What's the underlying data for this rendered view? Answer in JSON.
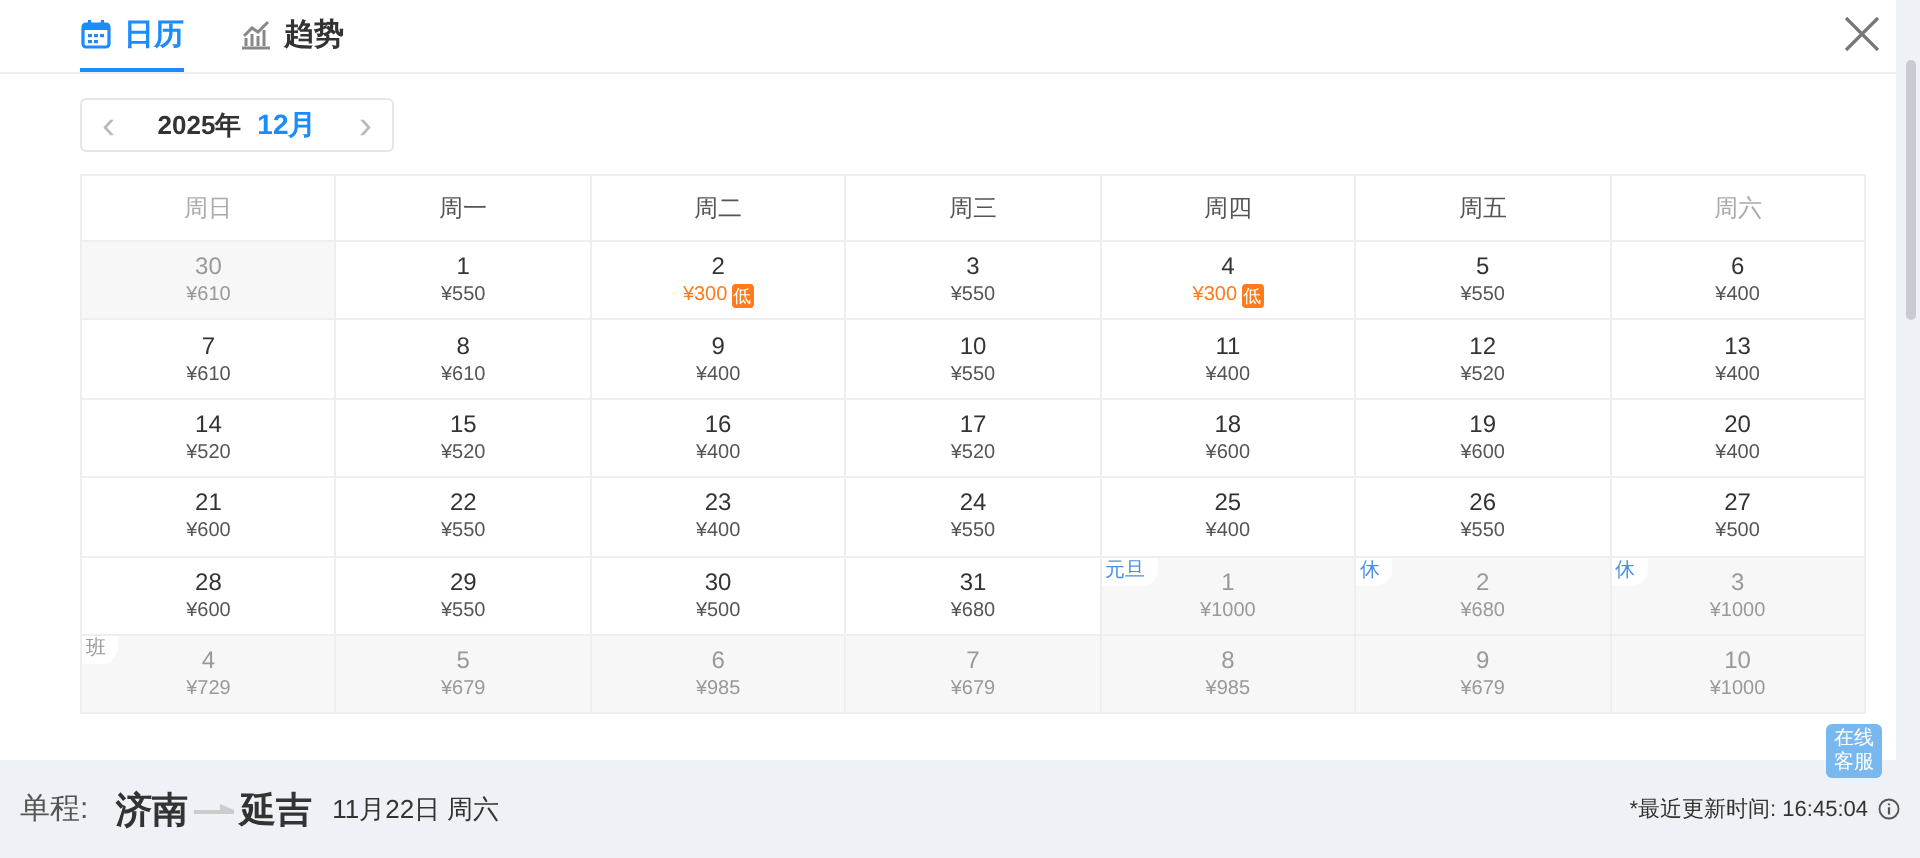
{
  "tabs": [
    {
      "label": "日历",
      "selected": true
    },
    {
      "label": "趋势",
      "selected": false
    }
  ],
  "month_picker": {
    "year": "2025年",
    "month": "12月",
    "prev": "‹",
    "next": "›"
  },
  "weekdays": [
    {
      "label": "周日",
      "weekend": true
    },
    {
      "label": "周一",
      "weekend": false
    },
    {
      "label": "周二",
      "weekend": false
    },
    {
      "label": "周三",
      "weekend": false
    },
    {
      "label": "周四",
      "weekend": false
    },
    {
      "label": "周五",
      "weekend": false
    },
    {
      "label": "周六",
      "weekend": true
    }
  ],
  "weeks": [
    [
      {
        "day": "30",
        "price": "¥610",
        "other_month": true,
        "low": false
      },
      {
        "day": "1",
        "price": "¥550",
        "other_month": false,
        "low": false
      },
      {
        "day": "2",
        "price": "¥300",
        "other_month": false,
        "low": true,
        "badge": "低"
      },
      {
        "day": "3",
        "price": "¥550",
        "other_month": false,
        "low": false
      },
      {
        "day": "4",
        "price": "¥300",
        "other_month": false,
        "low": true,
        "badge": "低"
      },
      {
        "day": "5",
        "price": "¥550",
        "other_month": false,
        "low": false
      },
      {
        "day": "6",
        "price": "¥400",
        "other_month": false,
        "low": false
      }
    ],
    [
      {
        "day": "7",
        "price": "¥610",
        "other_month": false,
        "low": false
      },
      {
        "day": "8",
        "price": "¥610",
        "other_month": false,
        "low": false
      },
      {
        "day": "9",
        "price": "¥400",
        "other_month": false,
        "low": false
      },
      {
        "day": "10",
        "price": "¥550",
        "other_month": false,
        "low": false
      },
      {
        "day": "11",
        "price": "¥400",
        "other_month": false,
        "low": false
      },
      {
        "day": "12",
        "price": "¥520",
        "other_month": false,
        "low": false
      },
      {
        "day": "13",
        "price": "¥400",
        "other_month": false,
        "low": false
      }
    ],
    [
      {
        "day": "14",
        "price": "¥520",
        "other_month": false,
        "low": false
      },
      {
        "day": "15",
        "price": "¥520",
        "other_month": false,
        "low": false
      },
      {
        "day": "16",
        "price": "¥400",
        "other_month": false,
        "low": false
      },
      {
        "day": "17",
        "price": "¥520",
        "other_month": false,
        "low": false
      },
      {
        "day": "18",
        "price": "¥600",
        "other_month": false,
        "low": false
      },
      {
        "day": "19",
        "price": "¥600",
        "other_month": false,
        "low": false
      },
      {
        "day": "20",
        "price": "¥400",
        "other_month": false,
        "low": false
      }
    ],
    [
      {
        "day": "21",
        "price": "¥600",
        "other_month": false,
        "low": false
      },
      {
        "day": "22",
        "price": "¥550",
        "other_month": false,
        "low": false
      },
      {
        "day": "23",
        "price": "¥400",
        "other_month": false,
        "low": false
      },
      {
        "day": "24",
        "price": "¥550",
        "other_month": false,
        "low": false
      },
      {
        "day": "25",
        "price": "¥400",
        "other_month": false,
        "low": false
      },
      {
        "day": "26",
        "price": "¥550",
        "other_month": false,
        "low": false
      },
      {
        "day": "27",
        "price": "¥500",
        "other_month": false,
        "low": false
      }
    ],
    [
      {
        "day": "28",
        "price": "¥600",
        "other_month": false,
        "low": false
      },
      {
        "day": "29",
        "price": "¥550",
        "other_month": false,
        "low": false
      },
      {
        "day": "30",
        "price": "¥500",
        "other_month": false,
        "low": false
      },
      {
        "day": "31",
        "price": "¥680",
        "other_month": false,
        "low": false
      },
      {
        "day": "1",
        "price": "¥1000",
        "other_month": true,
        "low": false,
        "tag": {
          "text": "元旦",
          "kind": "holiday"
        }
      },
      {
        "day": "2",
        "price": "¥680",
        "other_month": true,
        "low": false,
        "tag": {
          "text": "休",
          "kind": "holiday"
        }
      },
      {
        "day": "3",
        "price": "¥1000",
        "other_month": true,
        "low": false,
        "tag": {
          "text": "休",
          "kind": "holiday"
        }
      }
    ],
    [
      {
        "day": "4",
        "price": "¥729",
        "other_month": true,
        "low": false,
        "tag": {
          "text": "班",
          "kind": "workday"
        }
      },
      {
        "day": "5",
        "price": "¥679",
        "other_month": true,
        "low": false
      },
      {
        "day": "6",
        "price": "¥985",
        "other_month": true,
        "low": false
      },
      {
        "day": "7",
        "price": "¥679",
        "other_month": true,
        "low": false
      },
      {
        "day": "8",
        "price": "¥985",
        "other_month": true,
        "low": false
      },
      {
        "day": "9",
        "price": "¥679",
        "other_month": true,
        "low": false
      },
      {
        "day": "10",
        "price": "¥1000",
        "other_month": true,
        "low": false
      }
    ]
  ],
  "chat_button": "在线客服",
  "footer": {
    "trip_type": "单程:",
    "from": "济南",
    "to": "延吉",
    "date": "11月22日 周六",
    "updated": "*最近更新时间: 16:45:04"
  }
}
